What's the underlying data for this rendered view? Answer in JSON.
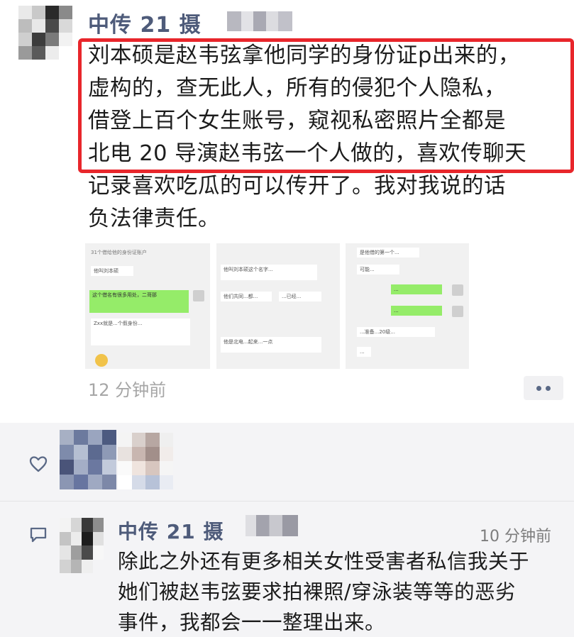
{
  "post": {
    "author": "中传 21 摄",
    "text_lines": [
      "刘本硕是赵韦弦拿他同学的身份证p出来的，",
      "虚构的，查无此人，所有的侵犯个人隐私，",
      "借登上百个女生账号，窥视私密照片全都是",
      "北电 20 导演赵韦弦一个人做的，喜欢传聊天",
      "记录喜欢吃瓜的可以传开了。我对我说的话",
      "负法律责任。"
    ],
    "time": "12 分钟前",
    "highlight_color": "#e8262b",
    "screenshots": {
      "shot1": {
        "b1": "31个借给他的身份证账户",
        "b2": "他叫刘本硕",
        "g1": "这个借名有很多用处，二哥那",
        "g2": "件事又被他...",
        "b3": "Zxx就是...个假身份...",
        "b4": "信息我...一个..."
      },
      "shot2": {
        "b1": "他叫刘本硕这个名字...",
        "b2": "他们共同...都...",
        "b3": "...已经...",
        "b4": "他是北电...起来...一点"
      },
      "shot3": {
        "b1": "是他借的第一个...",
        "b2": "可能...",
        "g1": "...",
        "g2": "...",
        "b3": "...准备...20级...",
        "b4": "..."
      }
    },
    "icons": {
      "more": "more-dots-icon",
      "emoji": "smile-emoji-icon"
    }
  },
  "interactions": {
    "like_icon": "heart-outline-icon",
    "comment_icon": "comment-bubble-icon",
    "comment": {
      "author": "中传 21 摄",
      "time": "10 分钟前",
      "text_lines": [
        "除此之外还有更多相关女性受害者私信我关于",
        "她们被赵韦弦要求拍裸照/穿泳装等等的恶劣",
        "事件，我都会一一整理出来。"
      ]
    },
    "link_color": "#4e5b7a"
  }
}
